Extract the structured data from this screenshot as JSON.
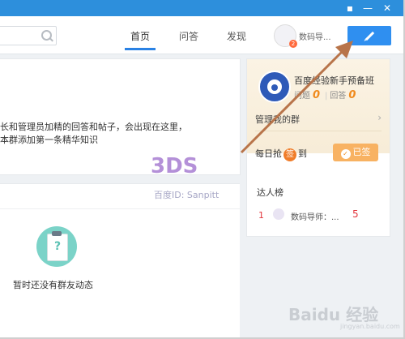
{
  "window": {
    "controls": [
      "pin-icon",
      "minimize-icon",
      "close-icon"
    ]
  },
  "nav": {
    "tabs": [
      {
        "label": "首页",
        "active": true
      },
      {
        "label": "问答",
        "active": false
      },
      {
        "label": "发现",
        "active": false
      }
    ],
    "username": "数码导...",
    "avatar_badge": "2",
    "compose_icon": "pencil-icon",
    "search_icon": "search-icon",
    "accent_color": "#2f8ff0"
  },
  "main": {
    "intro_line1": "长和管理员加精的回答和帖子，会出现在这里，",
    "intro_line2": "本群添加第一条精华知识",
    "empty_feed_text": "暂时还没有群友动态"
  },
  "watermark": {
    "logo_text": "3DS",
    "id_text": "百度ID: Sanpitt"
  },
  "side": {
    "group_name": "百度经验新手预备班",
    "questions_label": "问题",
    "questions_count": "0",
    "answers_label": "回答",
    "answers_count": "0",
    "manage_label": "管理我的群",
    "checkin_prefix": "每日抢",
    "checkin_badge": "签",
    "checkin_suffix": "到",
    "signed_button": "已签",
    "expert_title": "达人榜",
    "experts": [
      {
        "rank": "1",
        "name": "数码导师：...",
        "score": "5"
      }
    ]
  },
  "footer": {
    "brand": "Baidu 经验",
    "url": "jingyan.baidu.com"
  }
}
